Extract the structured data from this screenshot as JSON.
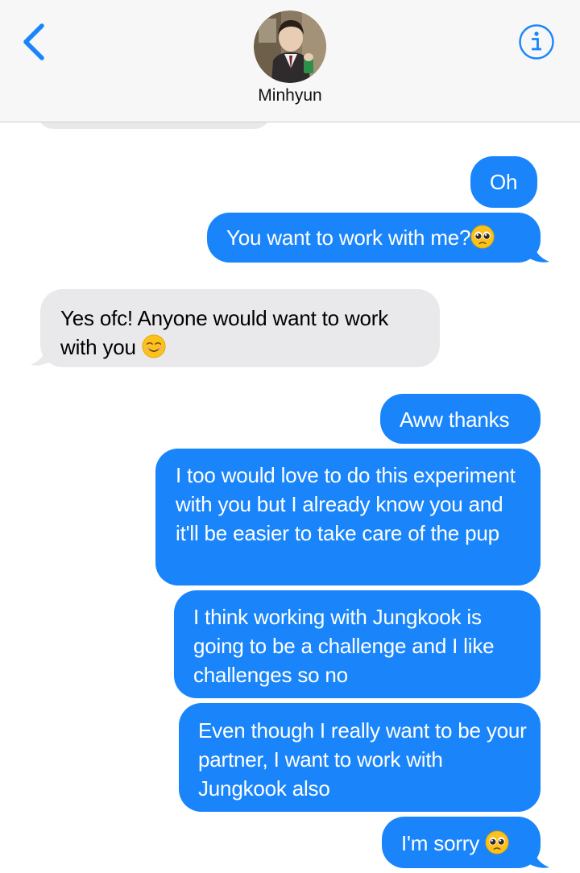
{
  "header": {
    "contact_name": "Minhyun",
    "back_icon": "chevron-left-icon",
    "info_icon": "info-icon",
    "accent_color": "#1a85fb"
  },
  "messages": [
    {
      "sender": "contact",
      "text": ""
    },
    {
      "sender": "me",
      "text": "Oh"
    },
    {
      "sender": "me",
      "text": "You want to work with me?",
      "emoji": "pleading-face"
    },
    {
      "sender": "contact",
      "text": "Yes ofc! Anyone would want to work with you",
      "emoji": "smiling-face"
    },
    {
      "sender": "me",
      "text": "Aww thanks"
    },
    {
      "sender": "me",
      "text": "I too would love to do this experiment with you but I already know you and it'll be easier to take care of the pup"
    },
    {
      "sender": "me",
      "text": "I think working with Jungkook is going to be a challenge and I like challenges so no"
    },
    {
      "sender": "me",
      "text": "Even though I really want to be your partner, I want to work with Jungkook also"
    },
    {
      "sender": "me",
      "text": "I'm sorry",
      "emoji": "pleading-face"
    }
  ],
  "colors": {
    "sent_bubble": "#1a85fb",
    "received_bubble": "#e9e9eb",
    "header_bg": "#f7f7f7"
  }
}
